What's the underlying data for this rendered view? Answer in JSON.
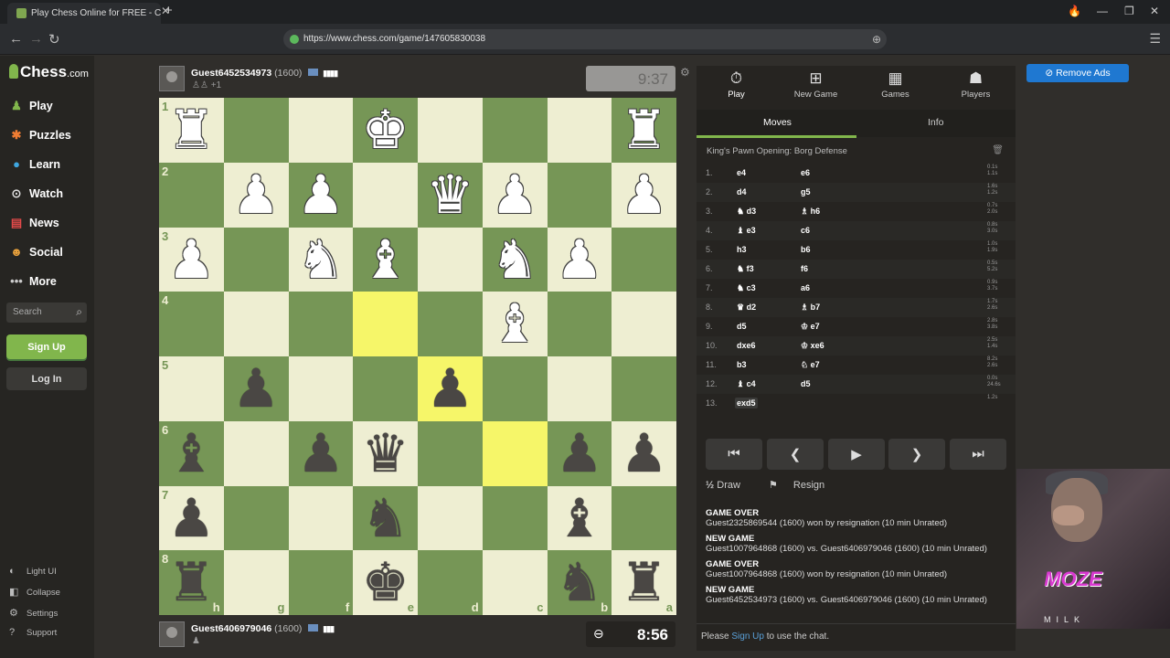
{
  "browser": {
    "tab_title": "Play Chess Online for FREE - C",
    "url": "https://www.chess.com/game/147605830038"
  },
  "sidebar": {
    "logo_main": "Chess",
    "logo_suffix": ".com",
    "items": [
      {
        "label": "Play",
        "icon": "pawn-icon"
      },
      {
        "label": "Puzzles",
        "icon": "puzzle-icon"
      },
      {
        "label": "Learn",
        "icon": "learn-icon"
      },
      {
        "label": "Watch",
        "icon": "binoculars-icon"
      },
      {
        "label": "News",
        "icon": "news-icon"
      },
      {
        "label": "Social",
        "icon": "social-icon"
      },
      {
        "label": "More",
        "icon": "more-icon"
      }
    ],
    "search_placeholder": "Search",
    "signup": "Sign Up",
    "login": "Log In",
    "footer": [
      {
        "label": "Light UI",
        "icon": "half-circle-icon"
      },
      {
        "label": "Collapse",
        "icon": "collapse-icon"
      },
      {
        "label": "Settings",
        "icon": "gear-icon"
      },
      {
        "label": "Support",
        "icon": "help-icon"
      }
    ]
  },
  "top_player": {
    "name": "Guest6452534973",
    "rating": "(1600)",
    "sub": "+1",
    "clock": "9:37"
  },
  "bottom_player": {
    "name": "Guest6406979046",
    "rating": "(1600)",
    "clock": "8:56"
  },
  "board": {
    "rank_labels": [
      "1",
      "2",
      "3",
      "4",
      "5",
      "6",
      "7",
      "8"
    ],
    "file_labels": [
      "h",
      "g",
      "f",
      "e",
      "d",
      "c",
      "b",
      "a"
    ],
    "highlighted": [
      "r4c3",
      "r5c4",
      "r6c5"
    ],
    "pieces": [
      {
        "sq": "r1c0",
        "p": "♜",
        "c": "w"
      },
      {
        "sq": "r1c3",
        "p": "♚",
        "c": "w"
      },
      {
        "sq": "r1c7",
        "p": "♜",
        "c": "w"
      },
      {
        "sq": "r2c1",
        "p": "♟",
        "c": "w"
      },
      {
        "sq": "r2c2",
        "p": "♟",
        "c": "w"
      },
      {
        "sq": "r2c4",
        "p": "♛",
        "c": "w"
      },
      {
        "sq": "r2c5",
        "p": "♟",
        "c": "w"
      },
      {
        "sq": "r2c7",
        "p": "♟",
        "c": "w"
      },
      {
        "sq": "r3c0",
        "p": "♟",
        "c": "w"
      },
      {
        "sq": "r3c2",
        "p": "♞",
        "c": "w"
      },
      {
        "sq": "r3c3",
        "p": "♝",
        "c": "w"
      },
      {
        "sq": "r3c5",
        "p": "♞",
        "c": "w"
      },
      {
        "sq": "r3c6",
        "p": "♟",
        "c": "w"
      },
      {
        "sq": "r4c5",
        "p": "♝",
        "c": "w"
      },
      {
        "sq": "r5c1",
        "p": "♟",
        "c": "b"
      },
      {
        "sq": "r5c4",
        "p": "♟",
        "c": "b"
      },
      {
        "sq": "r6c0",
        "p": "♝",
        "c": "b"
      },
      {
        "sq": "r6c2",
        "p": "♟",
        "c": "b"
      },
      {
        "sq": "r6c3",
        "p": "♛",
        "c": "b"
      },
      {
        "sq": "r6c6",
        "p": "♟",
        "c": "b"
      },
      {
        "sq": "r6c7",
        "p": "♟",
        "c": "b"
      },
      {
        "sq": "r7c0",
        "p": "♟",
        "c": "b"
      },
      {
        "sq": "r7c3",
        "p": "♞",
        "c": "b"
      },
      {
        "sq": "r7c6",
        "p": "♝",
        "c": "b"
      },
      {
        "sq": "r8c0",
        "p": "♜",
        "c": "b"
      },
      {
        "sq": "r8c3",
        "p": "♚",
        "c": "b"
      },
      {
        "sq": "r8c6",
        "p": "♞",
        "c": "b"
      },
      {
        "sq": "r8c7",
        "p": "♜",
        "c": "b"
      }
    ]
  },
  "panel": {
    "tabs": [
      {
        "label": "Play",
        "icon": "clock-icon"
      },
      {
        "label": "New Game",
        "icon": "plus-icon"
      },
      {
        "label": "Games",
        "icon": "board-icon"
      },
      {
        "label": "Players",
        "icon": "players-icon"
      }
    ],
    "subtabs": [
      "Moves",
      "Info"
    ],
    "opening": "King's Pawn Opening: Borg Defense",
    "moves": [
      {
        "n": "1.",
        "w": "e4",
        "b": "e6",
        "tw": "0.1s",
        "tb": "1.1s"
      },
      {
        "n": "2.",
        "w": "d4",
        "b": "g5",
        "tw": "1.6s",
        "tb": "1.2s"
      },
      {
        "n": "3.",
        "w": "♞ d3",
        "b": "♗ h6",
        "tw": "0.7s",
        "tb": "2.0s"
      },
      {
        "n": "4.",
        "w": "♝ e3",
        "b": "c6",
        "tw": "0.8s",
        "tb": "3.0s"
      },
      {
        "n": "5.",
        "w": "h3",
        "b": "b6",
        "tw": "1.0s",
        "tb": "1.9s"
      },
      {
        "n": "6.",
        "w": "♞ f3",
        "b": "f6",
        "tw": "0.5s",
        "tb": "5.2s"
      },
      {
        "n": "7.",
        "w": "♞ c3",
        "b": "a6",
        "tw": "0.9s",
        "tb": "3.7s"
      },
      {
        "n": "8.",
        "w": "♛ d2",
        "b": "♗ b7",
        "tw": "1.7s",
        "tb": "2.6s"
      },
      {
        "n": "9.",
        "w": "d5",
        "b": "♔ e7",
        "tw": "2.8s",
        "tb": "3.8s"
      },
      {
        "n": "10.",
        "w": "dxe6",
        "b": "♔ xe6",
        "tw": "2.5s",
        "tb": "1.4s"
      },
      {
        "n": "11.",
        "w": "b3",
        "b": "♘ e7",
        "tw": "8.2s",
        "tb": "2.6s"
      },
      {
        "n": "12.",
        "w": "♝ c4",
        "b": "d5",
        "tw": "0.0s",
        "tb": "24.6s"
      },
      {
        "n": "13.",
        "w": "exd5",
        "b": "",
        "tw": "1.2s",
        "tb": ""
      }
    ],
    "actions": {
      "draw": "Draw",
      "resign": "Resign"
    },
    "chat": [
      {
        "h": "GAME OVER",
        "l": "Guest2325869544 (1600) won by resignation (10 min Unrated)"
      },
      {
        "h": "NEW GAME",
        "l": "Guest1007964868 (1600) vs. Guest6406979046 (1600) (10 min Unrated)"
      },
      {
        "h": "GAME OVER",
        "l": "Guest1007964868 (1600) won by resignation (10 min Unrated)"
      },
      {
        "h": "NEW GAME",
        "l": "Guest6452534973 (1600) vs. Guest6406979046 (1600) (10 min Unrated)"
      }
    ],
    "chat_prefix": "Please",
    "chat_link": "Sign Up",
    "chat_suffix": "to use the chat."
  },
  "remove_ads": "Remove Ads",
  "webcam": {
    "logo": "MOZE",
    "sub": "MILK"
  }
}
